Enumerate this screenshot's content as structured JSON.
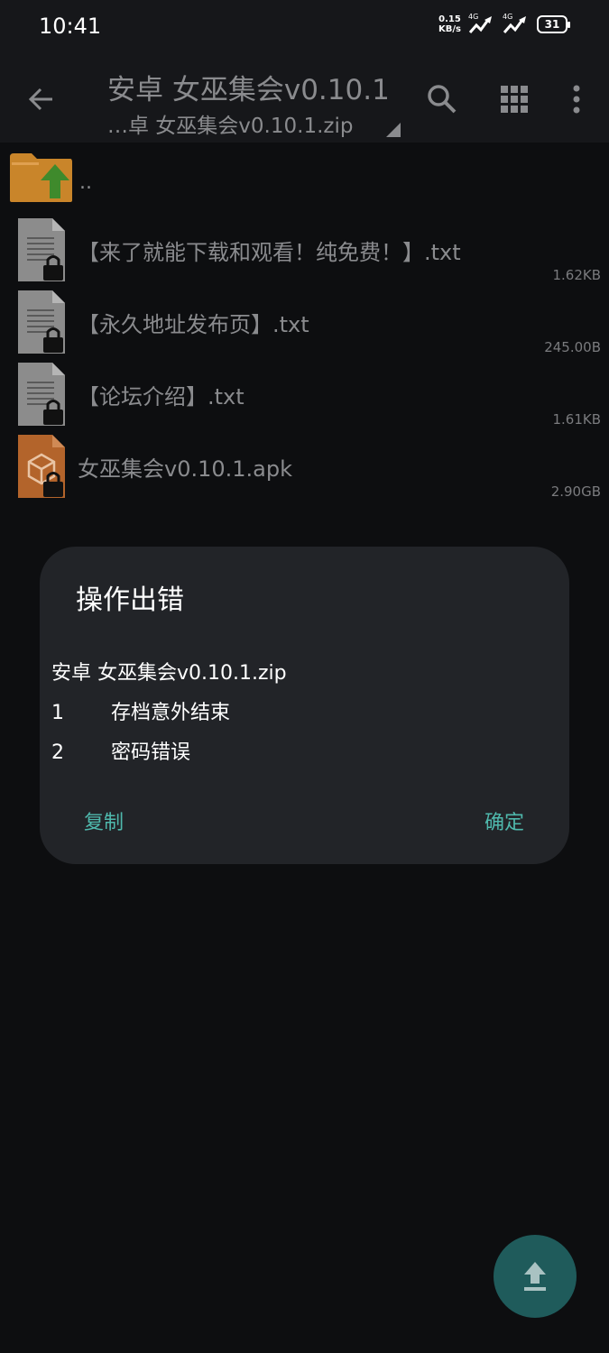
{
  "status_bar": {
    "time": "10:41",
    "net_speed_value": "0.15",
    "net_speed_unit": "KB/s",
    "signal1_label": "4G",
    "signal2_label": "4G",
    "battery": "31"
  },
  "app_bar": {
    "title": "安卓 女巫集会v0.10.1",
    "subtitle": "…卓 女巫集会v0.10.1.zip"
  },
  "file_list": {
    "parent_label": "..",
    "files": [
      {
        "name": "【来了就能下载和观看！纯免费！】.txt",
        "size": "1.62KB",
        "type": "txt"
      },
      {
        "name": "【永久地址发布页】.txt",
        "size": "245.00B",
        "type": "txt"
      },
      {
        "name": "【论坛介绍】.txt",
        "size": "1.61KB",
        "type": "txt"
      },
      {
        "name": "女巫集会v0.10.1.apk",
        "size": "2.90GB",
        "type": "apk"
      }
    ]
  },
  "dialog": {
    "title": "操作出错",
    "archive": "安卓 女巫集会v0.10.1.zip",
    "errors": [
      {
        "num": "1",
        "text": "存档意外结束"
      },
      {
        "num": "2",
        "text": "密码错误"
      }
    ],
    "copy_label": "复制",
    "ok_label": "确定"
  },
  "colors": {
    "accent": "#4fb9ad",
    "fab": "#1f5b5b",
    "dialog_bg": "#222428",
    "folder": "#c9852a",
    "apk": "#b3642b"
  },
  "icons": {
    "back": "arrow-left-icon",
    "search": "search-icon",
    "grid": "grid-view-icon",
    "more": "more-vert-icon",
    "fab": "upload-icon"
  }
}
